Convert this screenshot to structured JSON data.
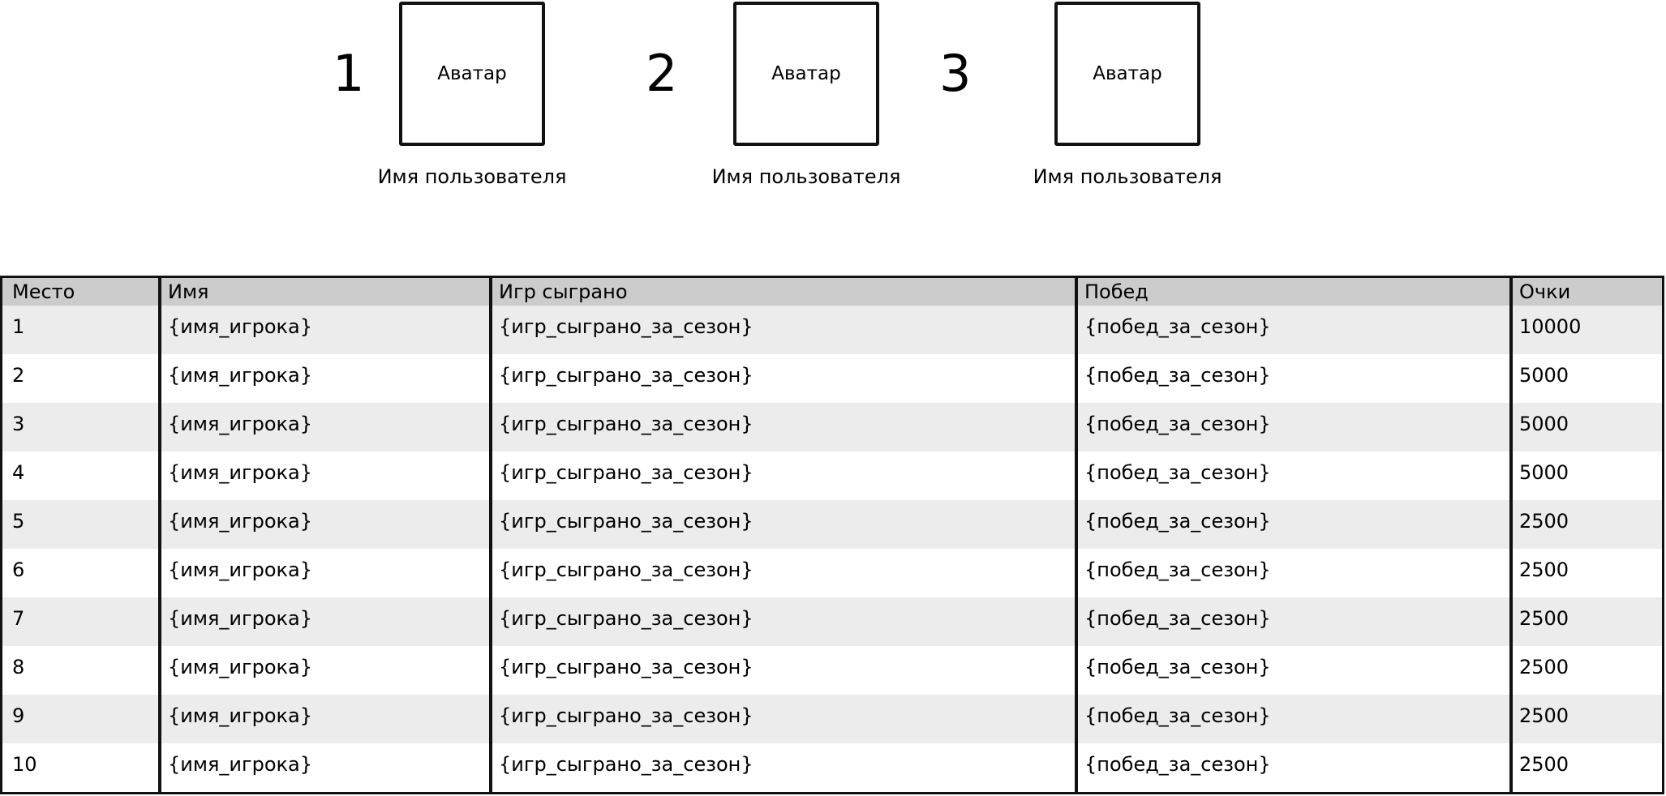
{
  "podium": [
    {
      "rank": "1",
      "avatar_label": "Аватар",
      "username": "Имя пользователя"
    },
    {
      "rank": "2",
      "avatar_label": "Аватар",
      "username": "Имя пользователя"
    },
    {
      "rank": "3",
      "avatar_label": "Аватар",
      "username": "Имя пользователя"
    }
  ],
  "table": {
    "headers": [
      "Место",
      "Имя",
      "Игр сыграно",
      "Побед",
      "Очки"
    ],
    "rows": [
      [
        "1",
        "{имя_игрока}",
        "{игр_сыграно_за_сезон}",
        "{побед_за_сезон}",
        "10000"
      ],
      [
        "2",
        "{имя_игрока}",
        "{игр_сыграно_за_сезон}",
        "{побед_за_сезон}",
        "5000"
      ],
      [
        "3",
        "{имя_игрока}",
        "{игр_сыграно_за_сезон}",
        "{побед_за_сезон}",
        "5000"
      ],
      [
        "4",
        "{имя_игрока}",
        "{игр_сыграно_за_сезон}",
        "{побед_за_сезон}",
        "5000"
      ],
      [
        "5",
        "{имя_игрока}",
        "{игр_сыграно_за_сезон}",
        "{побед_за_сезон}",
        "2500"
      ],
      [
        "6",
        "{имя_игрока}",
        "{игр_сыграно_за_сезон}",
        "{побед_за_сезон}",
        "2500"
      ],
      [
        "7",
        "{имя_игрока}",
        "{игр_сыграно_за_сезон}",
        "{побед_за_сезон}",
        "2500"
      ],
      [
        "8",
        "{имя_игрока}",
        "{игр_сыграно_за_сезон}",
        "{побед_за_сезон}",
        "2500"
      ],
      [
        "9",
        "{имя_игрока}",
        "{игр_сыграно_за_сезон}",
        "{побед_за_сезон}",
        "2500"
      ],
      [
        "10",
        "{имя_игрока}",
        "{игр_сыграно_за_сезон}",
        "{побед_за_сезон}",
        "2500"
      ]
    ]
  }
}
